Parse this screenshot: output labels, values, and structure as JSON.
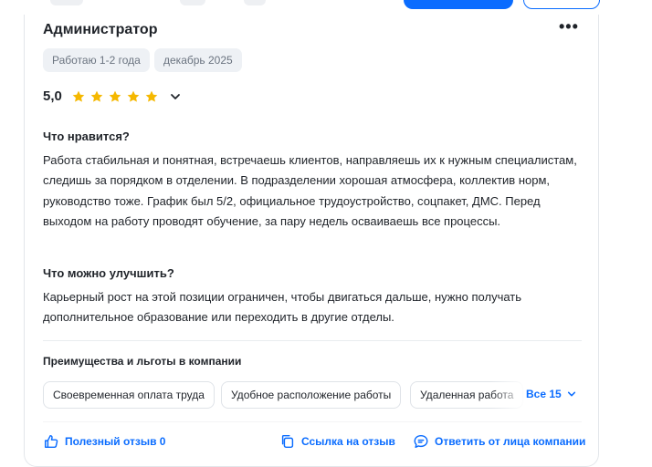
{
  "review": {
    "title": "Администратор",
    "more_label": "•••",
    "chips": [
      "Работаю 1-2 года",
      "декабрь 2025"
    ],
    "rating": "5,0",
    "stars": 5,
    "likes_heading": "Что нравится?",
    "likes_text": "Работа стабильная и понятная, встречаешь клиентов, направляешь их к нужным специалистам, следишь за порядком в отделении. В подразделении хорошая атмосфера, коллектив норм, руководство тоже. График был 5/2, официальное трудоустройство, соцпакет, ДМС. Перед выходом на работу проводят обучение, за пару недель осваиваешь все процессы.",
    "improve_heading": "Что можно улучшить?",
    "improve_text": "Карьерный рост на этой позиции ограничен, чтобы двигаться дальше, нужно получать дополнительное образование или переходить в другие отделы."
  },
  "benefits": {
    "heading": "Преимущества и льготы в компании",
    "items": [
      "Своевременная оплата труда",
      "Удобное расположение работы",
      "Удаленная работа"
    ],
    "all_label": "Все 15"
  },
  "actions": {
    "helpful": "Полезный отзыв 0",
    "link": "Ссылка на отзыв",
    "reply": "Ответить от лица компании"
  },
  "colors": {
    "accent": "#0a6cff",
    "star": "#f5b800"
  }
}
